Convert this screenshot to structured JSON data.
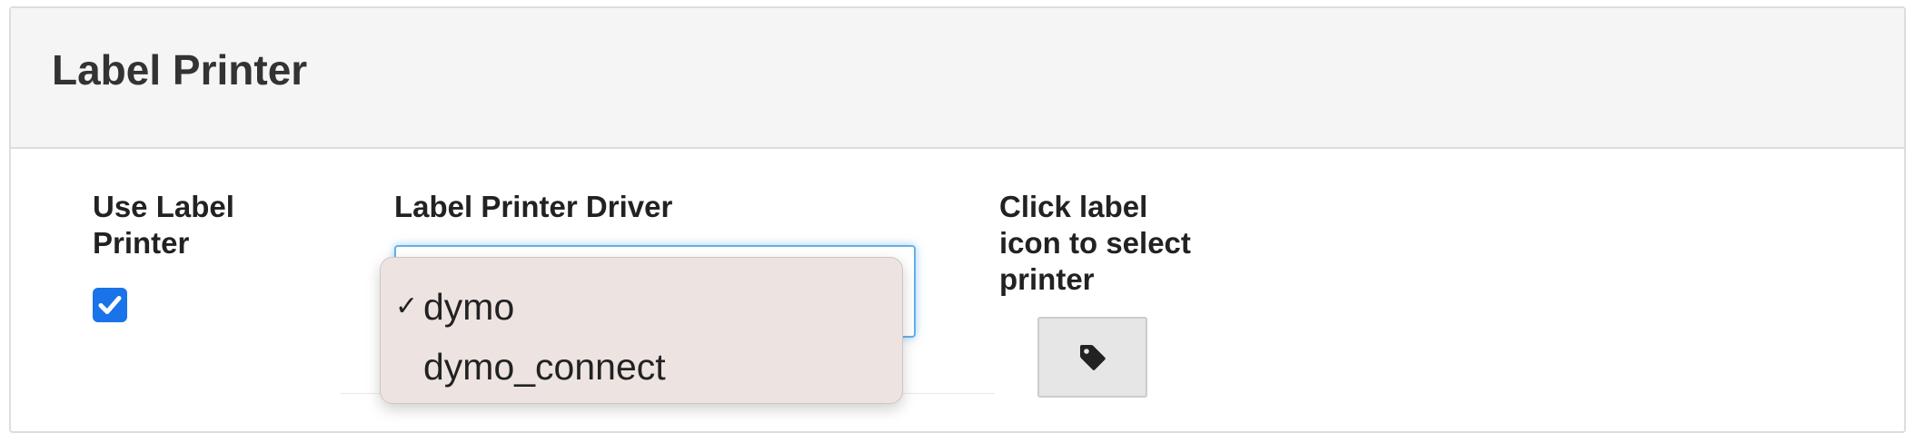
{
  "panel": {
    "title": "Label Printer"
  },
  "fields": {
    "use_label_printer": {
      "label_line1": "Use Label",
      "label_line2": "Printer",
      "checked": true
    },
    "driver": {
      "label": "Label Printer Driver",
      "selected": "dymo",
      "options": [
        "dymo",
        "dymo_connect"
      ],
      "dropdown_open": true,
      "check_mark": "✓"
    },
    "select_printer": {
      "label_line1": "Click label",
      "label_line2": "icon to select",
      "label_line3": "printer",
      "icon": "tag-icon"
    }
  },
  "colors": {
    "accent": "#1a73e8",
    "focus_border": "#66afe9",
    "heading_bg": "#f5f5f5",
    "dropdown_bg": "#ede4e2",
    "button_bg": "#e6e6e6"
  }
}
